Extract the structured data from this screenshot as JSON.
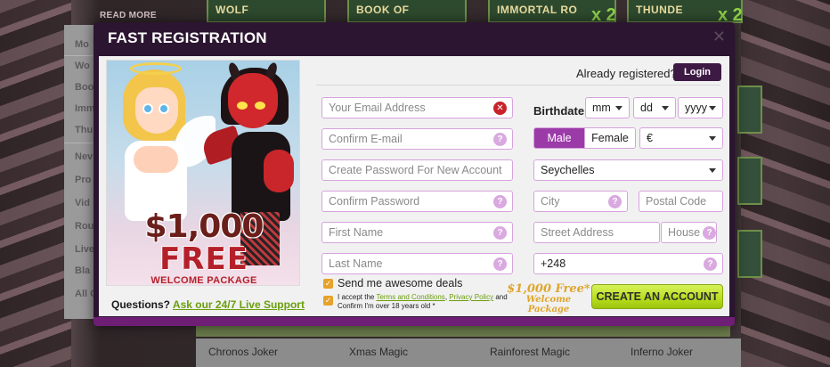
{
  "background": {
    "read_more": "READ MORE",
    "menu_items": [
      "Mo",
      "Wo",
      "Boo",
      "Imm",
      "Thu",
      "Nev",
      "Pro",
      "Vid",
      "Rou",
      "Live",
      "Bla",
      "All C"
    ],
    "top_tiles": [
      "WOLF",
      "BOOK OF",
      "IMMORTAL RO",
      "THUNDE"
    ],
    "tile_multiplier": "x 2",
    "games": [
      "Chronos Joker",
      "Xmas Magic",
      "Rainforest Magic",
      "Inferno Joker"
    ]
  },
  "modal": {
    "title": "FAST REGISTRATION",
    "close_icon": "✕",
    "promo": {
      "amount": "$1,000",
      "free": "FREE",
      "package": "WELCOME PACKAGE"
    },
    "support": {
      "question": "Questions?",
      "link": "Ask our 24/7 Live Support"
    },
    "already_registered": "Already registered?",
    "login_label": "Login",
    "fields": {
      "email": "Your Email Address",
      "confirm_email": "Confirm E-mail",
      "password": "Create Password For New Account",
      "confirm_password": "Confirm Password",
      "first_name": "First Name",
      "last_name": "Last Name",
      "city": "City",
      "postal_code": "Postal Code",
      "street": "Street Address",
      "house": "House",
      "phone_value": "+248"
    },
    "birthdate": {
      "label": "Birthdate",
      "month": "mm",
      "day": "dd",
      "year": "yyyy"
    },
    "gender": {
      "male": "Male",
      "female": "Female",
      "selected": "Male"
    },
    "currency": "€",
    "country": "Seychelles",
    "deals_label": "Send me awesome deals",
    "terms": {
      "prefix": "I accept the",
      "terms_link": "Terms and Conditions",
      "sep": ",",
      "privacy_link": "Privacy Policy",
      "suffix": "and Confirm I'm over 18 years old *"
    },
    "bonus": {
      "line1": "$1,000 Free*",
      "line2": "Welcome Package"
    },
    "create_label": "CREATE AN ACCOUNT",
    "colors": {
      "header": "#2b1530",
      "accent": "#9b3ba8",
      "cta": "#b7dd1c",
      "link": "#6a9e0c"
    }
  }
}
